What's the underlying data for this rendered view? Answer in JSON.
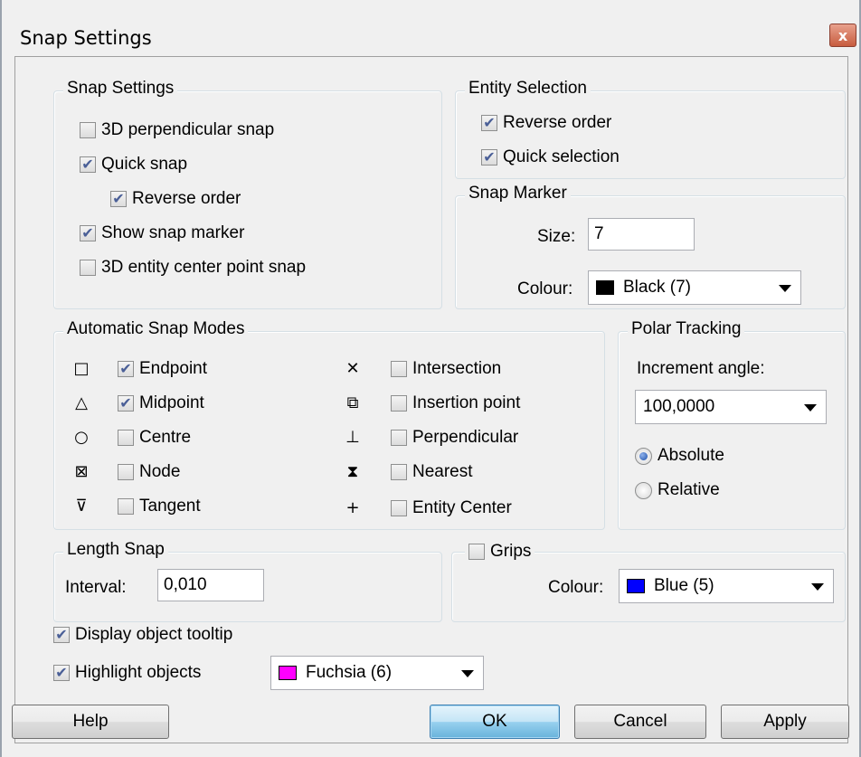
{
  "window": {
    "title": "Snap Settings",
    "close_label": "x"
  },
  "snap_settings": {
    "legend": "Snap Settings",
    "options": [
      {
        "label": "3D perpendicular snap",
        "checked": false
      },
      {
        "label": "Quick snap",
        "checked": true
      },
      {
        "label": "Reverse order",
        "checked": true
      },
      {
        "label": "Show snap marker",
        "checked": true
      },
      {
        "label": "3D entity center point snap",
        "checked": false
      }
    ]
  },
  "entity_selection": {
    "legend": "Entity Selection",
    "options": [
      {
        "label": "Reverse order",
        "checked": true
      },
      {
        "label": "Quick selection",
        "checked": true
      }
    ]
  },
  "snap_marker": {
    "legend": "Snap Marker",
    "size_label": "Size:",
    "size_value": "7",
    "colour_label": "Colour:",
    "colour_value": "Black (7)",
    "colour_hex": "#000000"
  },
  "auto_snap": {
    "legend": "Automatic Snap Modes",
    "modes": [
      {
        "icon": "endpoint-icon",
        "glyph": "□",
        "label": "Endpoint",
        "checked": true
      },
      {
        "icon": "midpoint-icon",
        "glyph": "△",
        "label": "Midpoint",
        "checked": true
      },
      {
        "icon": "centre-icon",
        "glyph": "○",
        "label": "Centre",
        "checked": false
      },
      {
        "icon": "node-icon",
        "glyph": "⊠",
        "label": "Node",
        "checked": false
      },
      {
        "icon": "tangent-icon",
        "glyph": "⊽",
        "label": "Tangent",
        "checked": false
      },
      {
        "icon": "intersection-icon",
        "glyph": "✕",
        "label": "Intersection",
        "checked": false
      },
      {
        "icon": "insertion-point-icon",
        "glyph": "⧉",
        "label": "Insertion point",
        "checked": false
      },
      {
        "icon": "perpendicular-icon",
        "glyph": "⊥",
        "label": "Perpendicular",
        "checked": false
      },
      {
        "icon": "nearest-icon",
        "glyph": "⧗",
        "label": "Nearest",
        "checked": false
      },
      {
        "icon": "entity-center-icon",
        "glyph": "+",
        "label": "Entity Center",
        "checked": false
      }
    ]
  },
  "polar_tracking": {
    "legend": "Polar Tracking",
    "increment_label": "Increment angle:",
    "increment_value": "100,0000",
    "absolute_label": "Absolute",
    "relative_label": "Relative",
    "selected": "Absolute"
  },
  "length_snap": {
    "legend": "Length Snap",
    "interval_label": "Interval:",
    "interval_value": "0,010"
  },
  "grips": {
    "label": "Grips",
    "checked": false,
    "colour_label": "Colour:",
    "colour_value": "Blue (5)",
    "colour_hex": "#0000ff"
  },
  "bottom": {
    "tooltip_label": "Display object tooltip",
    "tooltip_checked": true,
    "highlight_label": "Highlight objects",
    "highlight_checked": true,
    "highlight_colour": "Fuchsia (6)",
    "highlight_hex": "#ff00ff"
  },
  "buttons": {
    "help": "Help",
    "ok": "OK",
    "cancel": "Cancel",
    "apply": "Apply"
  }
}
